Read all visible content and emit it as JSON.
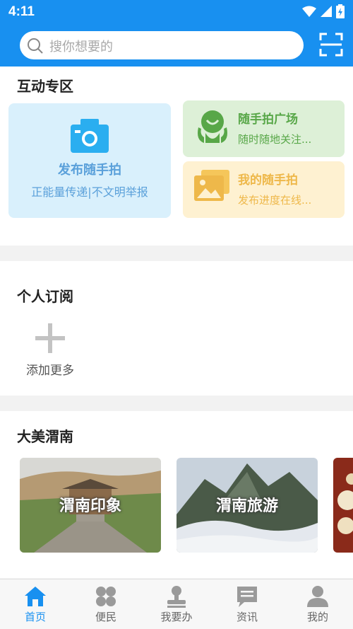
{
  "status_bar": {
    "time": "4:11"
  },
  "search": {
    "placeholder": "搜你想要的"
  },
  "interactive_zone": {
    "title": "互动专区",
    "main_card": {
      "title": "发布随手拍",
      "subtitle": "正能量传递|不文明举报"
    },
    "square_card": {
      "title": "随手拍广场",
      "subtitle": "随时随地关注..."
    },
    "mine_card": {
      "title": "我的随手拍",
      "subtitle": "发布进度在线..."
    }
  },
  "subscription": {
    "title": "个人订阅",
    "add_label": "添加更多"
  },
  "beauty": {
    "title": "大美渭南",
    "items": [
      {
        "label": "渭南印象"
      },
      {
        "label": "渭南旅游"
      }
    ]
  },
  "tabbar": {
    "items": [
      {
        "label": "首页",
        "active": true
      },
      {
        "label": "便民"
      },
      {
        "label": "我要办"
      },
      {
        "label": "资讯"
      },
      {
        "label": "我的"
      }
    ]
  },
  "colors": {
    "brand": "#1890f0",
    "green": "#58a748",
    "yellow": "#eeb84a",
    "lightblue": "#5aa0da"
  }
}
